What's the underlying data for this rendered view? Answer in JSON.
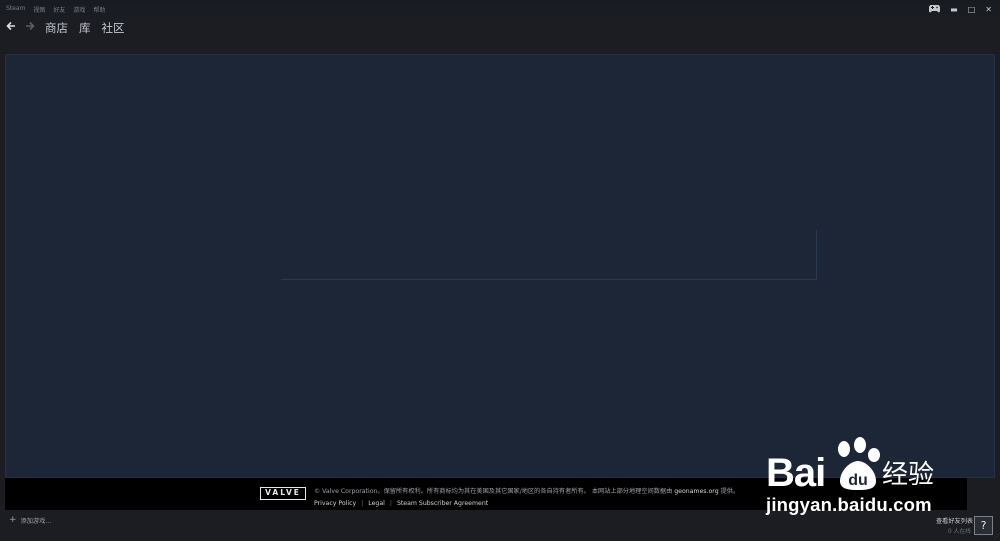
{
  "menubar": {
    "items": [
      "Steam",
      "视图",
      "好友",
      "游戏",
      "帮助"
    ]
  },
  "window_controls": {
    "controller_icon": "gamepad-icon",
    "minimize": "▬",
    "maximize": "□",
    "close": "✕"
  },
  "nav": {
    "back_icon": "arrow-left-icon",
    "forward_icon": "arrow-right-icon",
    "tabs": [
      "商店",
      "库",
      "社区"
    ]
  },
  "footer": {
    "logo_text": "VALVE",
    "copyright_text": "© Valve Corporation。保留所有权利。所有商标均为其在美国及其它国家/地区的各自持有者所有。 本网站上部分地理空间数据由",
    "geonames": "geonames.org",
    "provided": "提供。",
    "links": [
      "Privacy Policy",
      "Legal",
      "Steam Subscriber Agreement"
    ],
    "separator": "|"
  },
  "bottombar": {
    "add_game_label": "添加游戏...",
    "friends_label": "查看好友列表",
    "online_count": "0 人在线",
    "help_label": "?"
  },
  "watermark": {
    "brand": "Bai",
    "brand_suffix": "经验",
    "url": "jingyan.baidu.com"
  },
  "colors": {
    "background": "#1b1d22",
    "content": "#1c2636",
    "footer": "#000000"
  }
}
